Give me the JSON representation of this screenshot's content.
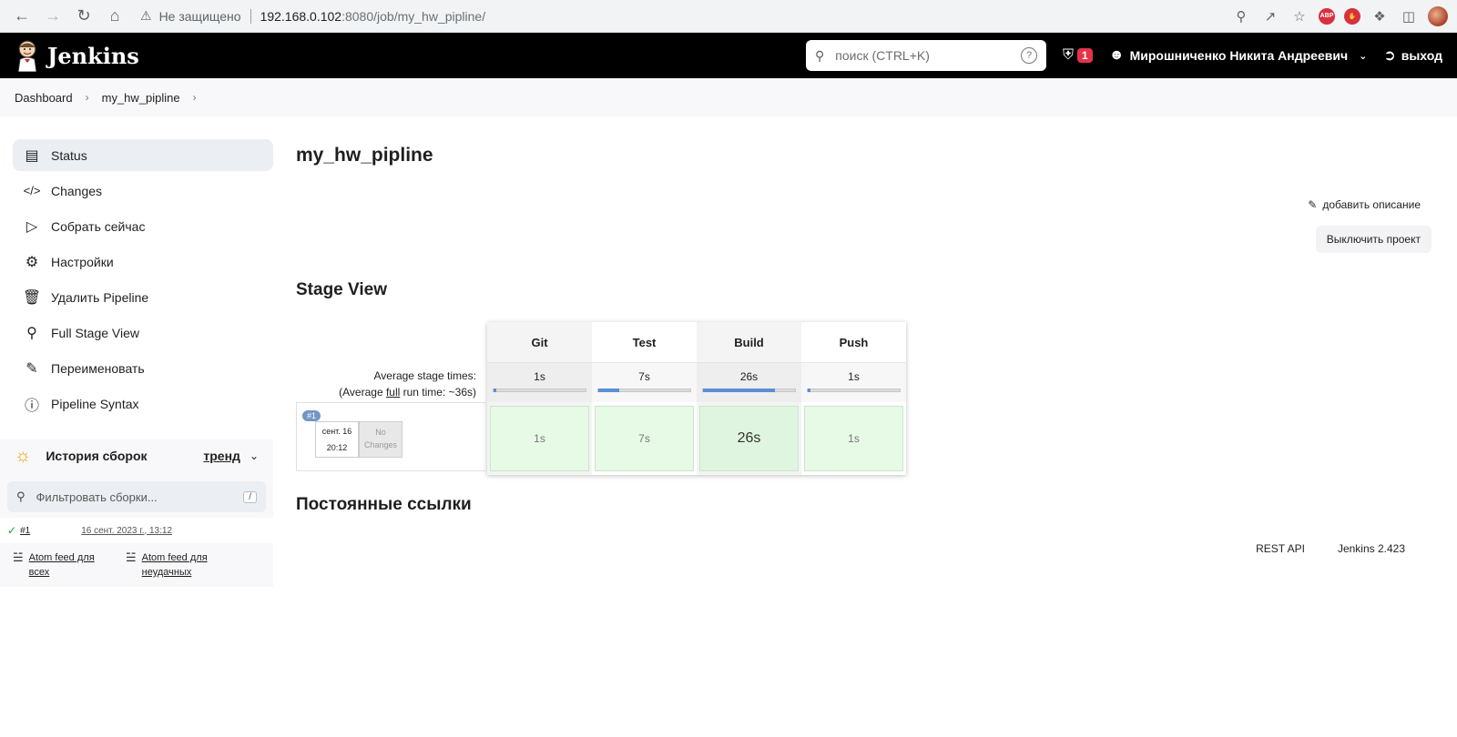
{
  "browser": {
    "insecure_label": "Не защищено",
    "url_host": "192.168.0.102",
    "url_path": ":8080/job/my_hw_pipline/",
    "ext_abp": "ABP"
  },
  "header": {
    "app_name": "Jenkins",
    "search_placeholder": "поиск (CTRL+K)",
    "alert_count": "1",
    "user_name": "Мирошниченко Никита Андреевич",
    "logout_label": "выход"
  },
  "breadcrumbs": {
    "items": [
      "Dashboard",
      "my_hw_pipline"
    ]
  },
  "sidebar": {
    "items": [
      {
        "label": "Status",
        "icon": "document-icon"
      },
      {
        "label": "Changes",
        "icon": "code-icon"
      },
      {
        "label": "Собрать сейчас",
        "icon": "play-icon"
      },
      {
        "label": "Настройки",
        "icon": "gear-icon"
      },
      {
        "label": "Удалить Pipeline",
        "icon": "trash-icon"
      },
      {
        "label": "Full Stage View",
        "icon": "search-icon"
      },
      {
        "label": "Переименовать",
        "icon": "pencil-icon"
      },
      {
        "label": "Pipeline Syntax",
        "icon": "help-icon"
      }
    ],
    "build_history": {
      "title": "История сборок",
      "trend_label": "тренд",
      "filter_placeholder": "Фильтровать сборки...",
      "filter_shortcut": "/",
      "builds": [
        {
          "number": "#1",
          "date": "16 сент. 2023 г., 13:12",
          "status": "success"
        }
      ],
      "feeds": [
        {
          "line1": "Atom feed для",
          "line2": "всех"
        },
        {
          "line1": "Atom feed для",
          "line2": "неудачных"
        }
      ]
    }
  },
  "main": {
    "title": "my_hw_pipline",
    "add_description": "добавить описание",
    "disable_project": "Выключить проект",
    "stage_view_title": "Stage View",
    "avg_label_1": "Average stage times:",
    "avg_label_2_prefix": "(Average ",
    "avg_label_2_full": "full",
    "avg_label_2_suffix": " run time: ~36s)",
    "stages": [
      {
        "name": "Git",
        "avg": "1s",
        "cell": "1s",
        "fraction": 0.03
      },
      {
        "name": "Test",
        "avg": "7s",
        "cell": "7s",
        "fraction": 0.23
      },
      {
        "name": "Build",
        "avg": "26s",
        "cell": "26s",
        "fraction": 0.78
      },
      {
        "name": "Push",
        "avg": "1s",
        "cell": "1s",
        "fraction": 0.03
      }
    ],
    "run": {
      "badge": "#1",
      "date": "сент. 16",
      "time": "20:12",
      "changes_line1": "No",
      "changes_line2": "Changes"
    },
    "permalinks_title": "Постоянные ссылки"
  },
  "footer": {
    "rest_api": "REST API",
    "version": "Jenkins 2.423"
  }
}
